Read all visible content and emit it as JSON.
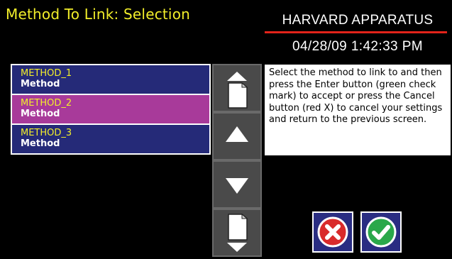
{
  "header": {
    "title": "Method To Link: Selection",
    "brand": "HARVARD APPARATUS",
    "datetime": "04/28/09 1:42:33 PM"
  },
  "methods": [
    {
      "name": "METHOD_1",
      "type": "Method",
      "selected": false
    },
    {
      "name": "METHOD_2",
      "type": "Method",
      "selected": true
    },
    {
      "name": "METHOD_3",
      "type": "Method",
      "selected": false
    }
  ],
  "help_text": "Select the method to link to and then press the Enter button (green check mark) to accept or press the Cancel button (red X) to cancel your settings and return to the previous screen.",
  "icons": {
    "page_up": "page-up-icon",
    "up": "arrow-up-icon",
    "down": "arrow-down-icon",
    "page_down": "page-down-icon",
    "cancel": "red-x-icon",
    "enter": "green-check-icon"
  },
  "colors": {
    "title_yellow": "#f2ee2a",
    "item_blue": "#252a78",
    "item_selected": "#a83a9a",
    "brand_line_red": "#e2231a",
    "cancel_red": "#d92b2b",
    "enter_green": "#2aa84a"
  }
}
